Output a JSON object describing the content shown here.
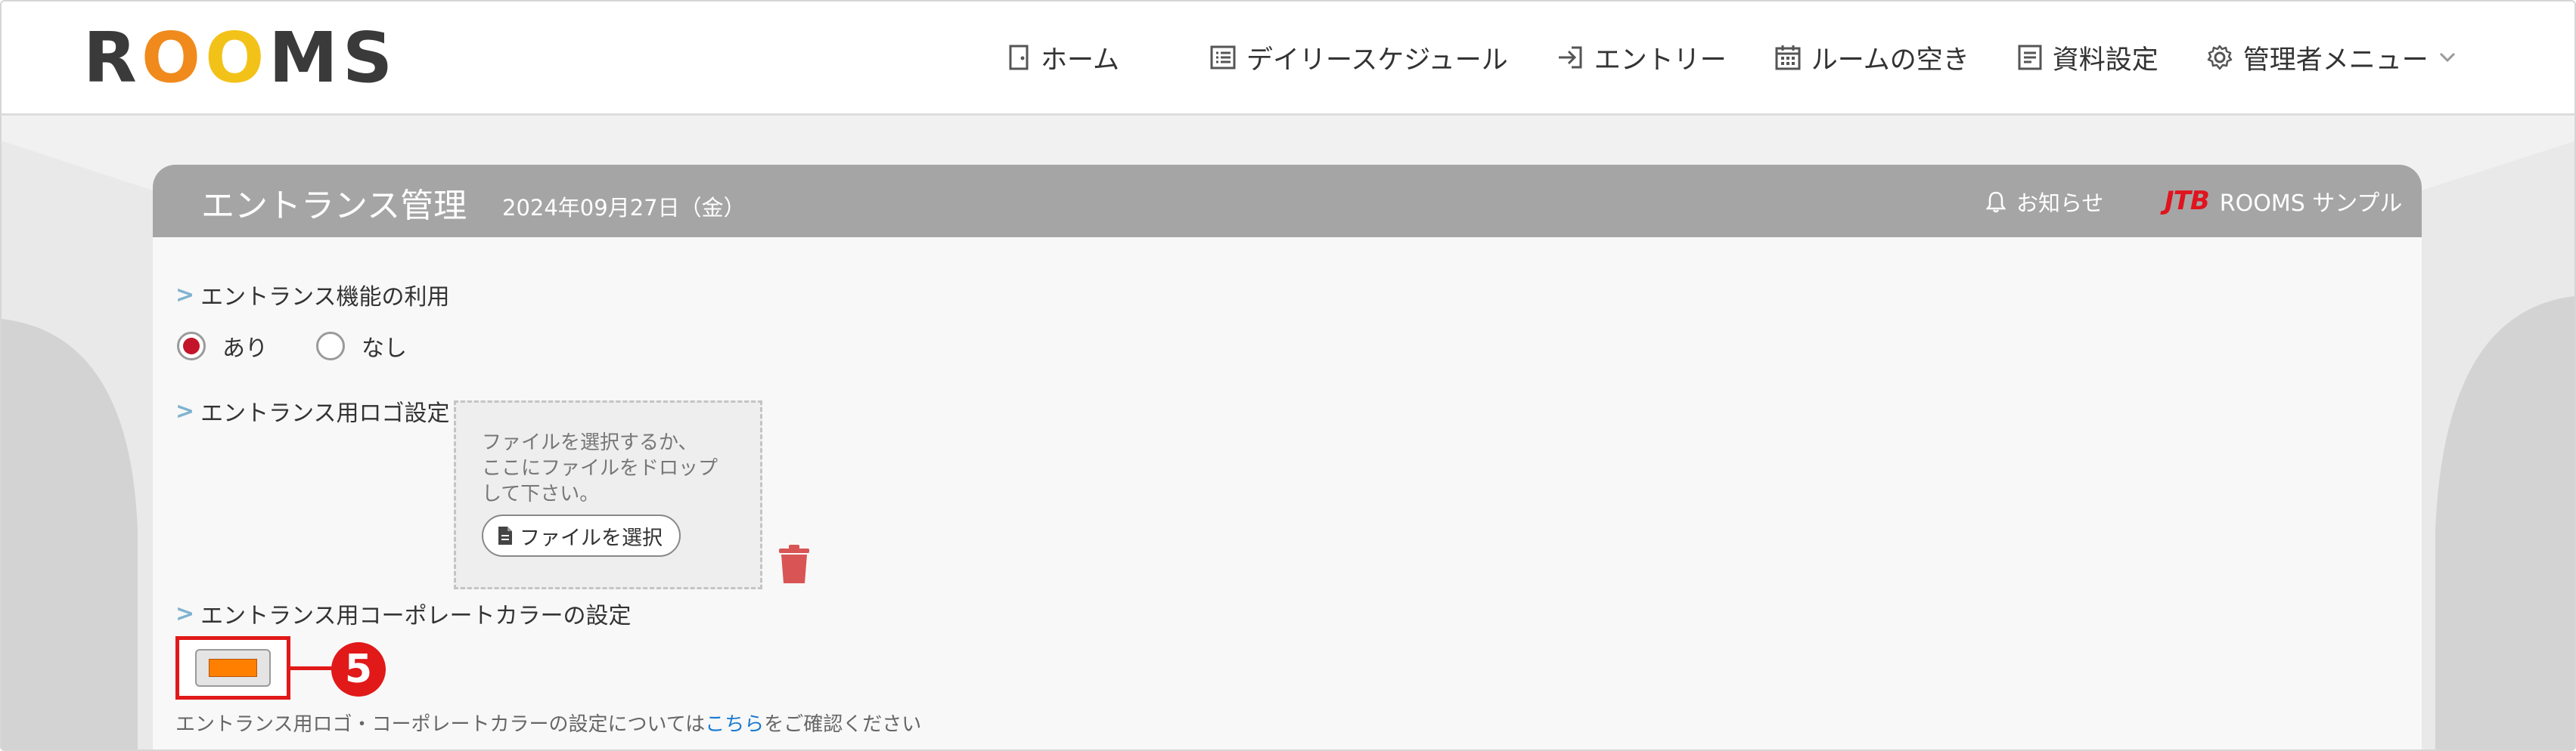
{
  "app": {
    "logo_letters": [
      {
        "ch": "R",
        "color": "#3a3a3a"
      },
      {
        "ch": "O",
        "color": "#f08a1c"
      },
      {
        "ch": "O",
        "color": "#f3c218"
      },
      {
        "ch": "M",
        "color": "#3a3a3a"
      },
      {
        "ch": "S",
        "color": "#3a3a3a"
      }
    ]
  },
  "nav": {
    "home": "ホーム",
    "daily": "デイリースケジュール",
    "entry": "エントリー",
    "rooms": "ルームの空き",
    "materials": "資料設定",
    "admin": "管理者メニュー"
  },
  "panel": {
    "title": "エントランス管理",
    "date": "2024年09月27日（金）",
    "notice": "お知らせ",
    "company_logo": "JTB",
    "company": "ROOMS サンプル"
  },
  "sections": {
    "use_label": "エントランス機能の利用",
    "radio_yes": "あり",
    "radio_no": "なし",
    "radio_selected": "あり",
    "logo_label": "エントランス用ロゴ設定",
    "dropzone_line1": "ファイルを選択するか、",
    "dropzone_line2": "ここにファイルをドロップ",
    "dropzone_line3": "して下さい。",
    "file_button": "ファイルを選択",
    "color_label": "エントランス用コーポレートカラーの設定",
    "corporate_color": "#ff8000",
    "callout_number": "5",
    "note_before": "エントランス用ロゴ・コーポレートカラーの設定については",
    "note_link": "こちら",
    "note_after": "をご確認ください"
  }
}
